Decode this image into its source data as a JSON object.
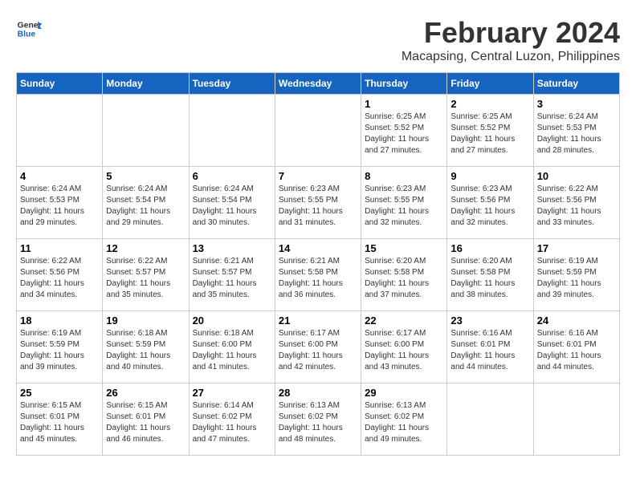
{
  "header": {
    "logo_line1": "General",
    "logo_line2": "Blue",
    "month_year": "February 2024",
    "location": "Macapsing, Central Luzon, Philippines"
  },
  "weekdays": [
    "Sunday",
    "Monday",
    "Tuesday",
    "Wednesday",
    "Thursday",
    "Friday",
    "Saturday"
  ],
  "weeks": [
    [
      {
        "day": "",
        "info": ""
      },
      {
        "day": "",
        "info": ""
      },
      {
        "day": "",
        "info": ""
      },
      {
        "day": "",
        "info": ""
      },
      {
        "day": "1",
        "info": "Sunrise: 6:25 AM\nSunset: 5:52 PM\nDaylight: 11 hours\nand 27 minutes."
      },
      {
        "day": "2",
        "info": "Sunrise: 6:25 AM\nSunset: 5:52 PM\nDaylight: 11 hours\nand 27 minutes."
      },
      {
        "day": "3",
        "info": "Sunrise: 6:24 AM\nSunset: 5:53 PM\nDaylight: 11 hours\nand 28 minutes."
      }
    ],
    [
      {
        "day": "4",
        "info": "Sunrise: 6:24 AM\nSunset: 5:53 PM\nDaylight: 11 hours\nand 29 minutes."
      },
      {
        "day": "5",
        "info": "Sunrise: 6:24 AM\nSunset: 5:54 PM\nDaylight: 11 hours\nand 29 minutes."
      },
      {
        "day": "6",
        "info": "Sunrise: 6:24 AM\nSunset: 5:54 PM\nDaylight: 11 hours\nand 30 minutes."
      },
      {
        "day": "7",
        "info": "Sunrise: 6:23 AM\nSunset: 5:55 PM\nDaylight: 11 hours\nand 31 minutes."
      },
      {
        "day": "8",
        "info": "Sunrise: 6:23 AM\nSunset: 5:55 PM\nDaylight: 11 hours\nand 32 minutes."
      },
      {
        "day": "9",
        "info": "Sunrise: 6:23 AM\nSunset: 5:56 PM\nDaylight: 11 hours\nand 32 minutes."
      },
      {
        "day": "10",
        "info": "Sunrise: 6:22 AM\nSunset: 5:56 PM\nDaylight: 11 hours\nand 33 minutes."
      }
    ],
    [
      {
        "day": "11",
        "info": "Sunrise: 6:22 AM\nSunset: 5:56 PM\nDaylight: 11 hours\nand 34 minutes."
      },
      {
        "day": "12",
        "info": "Sunrise: 6:22 AM\nSunset: 5:57 PM\nDaylight: 11 hours\nand 35 minutes."
      },
      {
        "day": "13",
        "info": "Sunrise: 6:21 AM\nSunset: 5:57 PM\nDaylight: 11 hours\nand 35 minutes."
      },
      {
        "day": "14",
        "info": "Sunrise: 6:21 AM\nSunset: 5:58 PM\nDaylight: 11 hours\nand 36 minutes."
      },
      {
        "day": "15",
        "info": "Sunrise: 6:20 AM\nSunset: 5:58 PM\nDaylight: 11 hours\nand 37 minutes."
      },
      {
        "day": "16",
        "info": "Sunrise: 6:20 AM\nSunset: 5:58 PM\nDaylight: 11 hours\nand 38 minutes."
      },
      {
        "day": "17",
        "info": "Sunrise: 6:19 AM\nSunset: 5:59 PM\nDaylight: 11 hours\nand 39 minutes."
      }
    ],
    [
      {
        "day": "18",
        "info": "Sunrise: 6:19 AM\nSunset: 5:59 PM\nDaylight: 11 hours\nand 39 minutes."
      },
      {
        "day": "19",
        "info": "Sunrise: 6:18 AM\nSunset: 5:59 PM\nDaylight: 11 hours\nand 40 minutes."
      },
      {
        "day": "20",
        "info": "Sunrise: 6:18 AM\nSunset: 6:00 PM\nDaylight: 11 hours\nand 41 minutes."
      },
      {
        "day": "21",
        "info": "Sunrise: 6:17 AM\nSunset: 6:00 PM\nDaylight: 11 hours\nand 42 minutes."
      },
      {
        "day": "22",
        "info": "Sunrise: 6:17 AM\nSunset: 6:00 PM\nDaylight: 11 hours\nand 43 minutes."
      },
      {
        "day": "23",
        "info": "Sunrise: 6:16 AM\nSunset: 6:01 PM\nDaylight: 11 hours\nand 44 minutes."
      },
      {
        "day": "24",
        "info": "Sunrise: 6:16 AM\nSunset: 6:01 PM\nDaylight: 11 hours\nand 44 minutes."
      }
    ],
    [
      {
        "day": "25",
        "info": "Sunrise: 6:15 AM\nSunset: 6:01 PM\nDaylight: 11 hours\nand 45 minutes."
      },
      {
        "day": "26",
        "info": "Sunrise: 6:15 AM\nSunset: 6:01 PM\nDaylight: 11 hours\nand 46 minutes."
      },
      {
        "day": "27",
        "info": "Sunrise: 6:14 AM\nSunset: 6:02 PM\nDaylight: 11 hours\nand 47 minutes."
      },
      {
        "day": "28",
        "info": "Sunrise: 6:13 AM\nSunset: 6:02 PM\nDaylight: 11 hours\nand 48 minutes."
      },
      {
        "day": "29",
        "info": "Sunrise: 6:13 AM\nSunset: 6:02 PM\nDaylight: 11 hours\nand 49 minutes."
      },
      {
        "day": "",
        "info": ""
      },
      {
        "day": "",
        "info": ""
      }
    ]
  ]
}
